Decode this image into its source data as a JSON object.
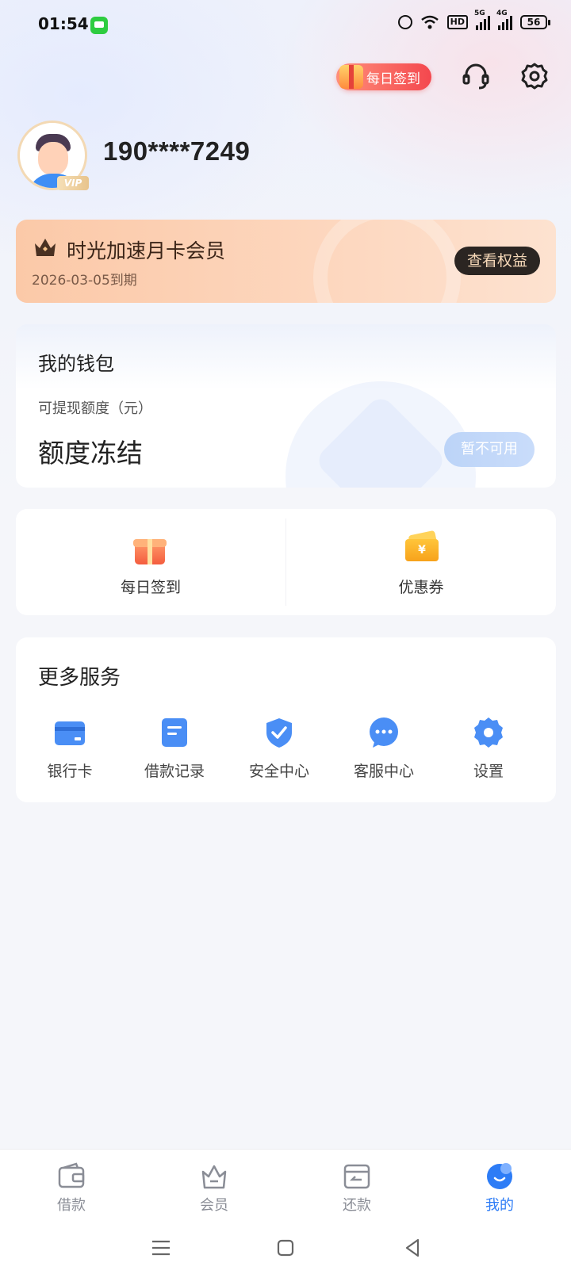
{
  "status_bar": {
    "time": "01:54",
    "hd_label": "HD",
    "net1_label": "5G",
    "net2_label": "4G",
    "battery": "56"
  },
  "header": {
    "checkin_label": "每日签到"
  },
  "profile": {
    "phone": "190****7249",
    "vip_label": "VIP"
  },
  "membership": {
    "title": "时光加速月卡会员",
    "expire": "2026-03-05到期",
    "button": "查看权益"
  },
  "wallet": {
    "title": "我的钱包",
    "subtitle": "可提现额度（元）",
    "status": "额度冻结",
    "button": "暂不可用"
  },
  "quick_actions": [
    {
      "label": "每日签到",
      "icon": "gift-icon"
    },
    {
      "label": "优惠券",
      "icon": "coupon-icon",
      "symbol": "¥"
    }
  ],
  "services": {
    "title": "更多服务",
    "items": [
      {
        "label": "银行卡",
        "icon": "bank-card-icon"
      },
      {
        "label": "借款记录",
        "icon": "document-icon"
      },
      {
        "label": "安全中心",
        "icon": "shield-check-icon"
      },
      {
        "label": "客服中心",
        "icon": "chat-bubble-icon"
      },
      {
        "label": "设置",
        "icon": "gear-icon"
      }
    ]
  },
  "tabbar": [
    {
      "label": "借款",
      "icon": "wallet-icon",
      "active": false
    },
    {
      "label": "会员",
      "icon": "crown-basket-icon",
      "active": false
    },
    {
      "label": "还款",
      "icon": "card-return-icon",
      "active": false
    },
    {
      "label": "我的",
      "icon": "smile-icon",
      "active": true
    }
  ],
  "colors": {
    "accent": "#2d7cf6",
    "service_icon": "#4a8ef5",
    "checkin_pill": "#f4474e",
    "member_button_bg": "#2b2522",
    "wallet_button": "#bcd4f8"
  }
}
